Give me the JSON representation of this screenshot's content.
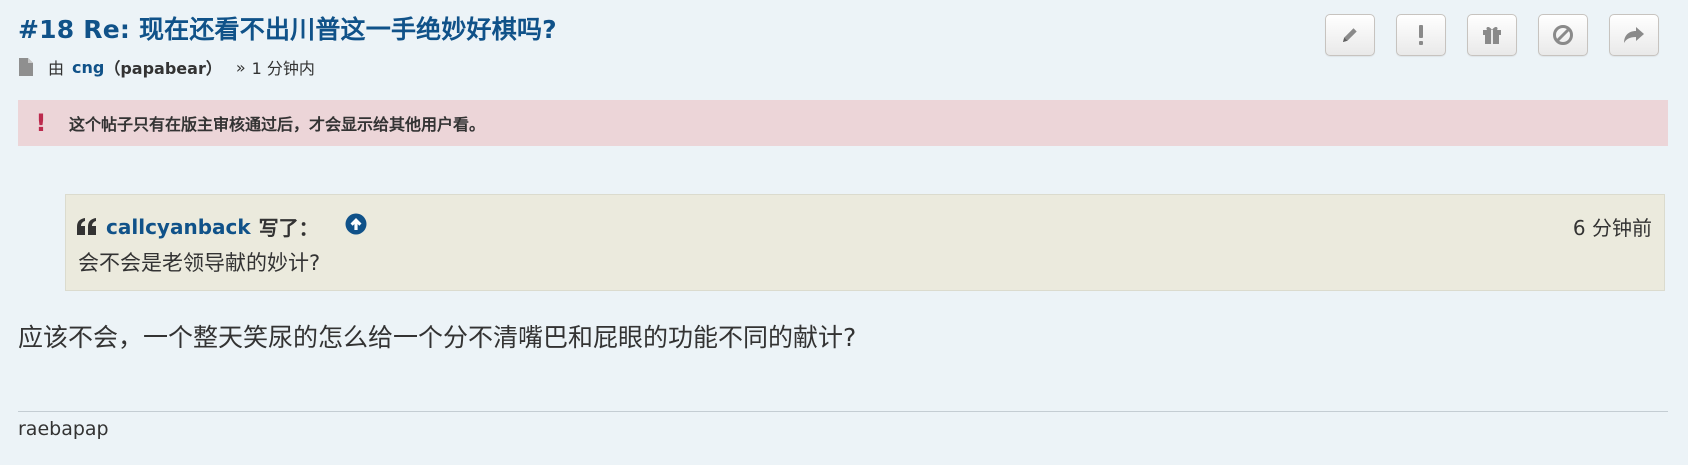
{
  "post": {
    "title": "#18 Re: 现在还看不出川普这一手绝妙好棋吗?",
    "by_label": "由",
    "author": "cng",
    "author_realname": "（papabear）",
    "time_sep": "»",
    "time": "1 分钟内",
    "notice": "这个帖子只有在版主审核通过后，才会显示给其他用户看。",
    "body": "应该不会，一个整天笑尿的怎么给一个分不清嘴巴和屁眼的功能不同的献计?",
    "signature": "raebapap"
  },
  "quote": {
    "user": "callcyanback",
    "wrote": "写了：",
    "time": "6 分钟前",
    "text": "会不会是老领导献的妙计?"
  },
  "toolbar": {
    "buttons": [
      "edit-icon",
      "report-icon",
      "gift-icon",
      "block-icon",
      "share-icon"
    ]
  },
  "colors": {
    "background": "#ecf3f7",
    "link": "#105289",
    "notice_bg": "#ecd5d8",
    "notice_icon": "#bc2a4d",
    "quote_bg": "#ebeadd"
  }
}
